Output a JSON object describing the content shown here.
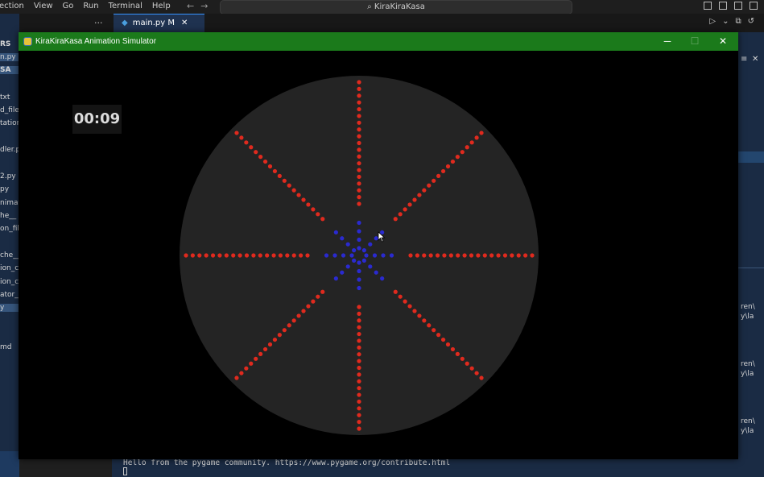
{
  "menu": [
    "ection",
    "View",
    "Go",
    "Run",
    "Terminal",
    "Help"
  ],
  "search": {
    "text": "KiraKiraKasa"
  },
  "sidebar": {
    "items": [
      "RS",
      "n.py",
      "SA",
      "txt",
      "d_file.",
      "tation",
      "dler.p",
      "2.py",
      "py",
      "nimat",
      "he__",
      "on_file",
      "che__",
      "ion_c",
      "ion_c",
      "ator_",
      "y",
      "md"
    ]
  },
  "tabs": [
    {
      "label": "main.py",
      "status": "M"
    }
  ],
  "terminal": {
    "line": "Hello from the pygame community. https://www.pygame.org/contribute.html",
    "right_text": [
      "ren\\",
      "y\\la",
      "ren\\",
      "y\\la",
      "ren\\",
      "y\\la"
    ]
  },
  "pygame_window": {
    "title": "KiraKiraKasa Animation Simulator",
    "timer": "00:09",
    "title_bar_color": "#1b7a1b"
  },
  "animation": {
    "spokes": 8,
    "outer_dots_per_spoke": 19,
    "inner_dots_per_spoke": 4,
    "outer_color": "#e02a1e",
    "inner_color": "#2a2ad0",
    "disc_color": "#242424",
    "background": "#000000"
  }
}
